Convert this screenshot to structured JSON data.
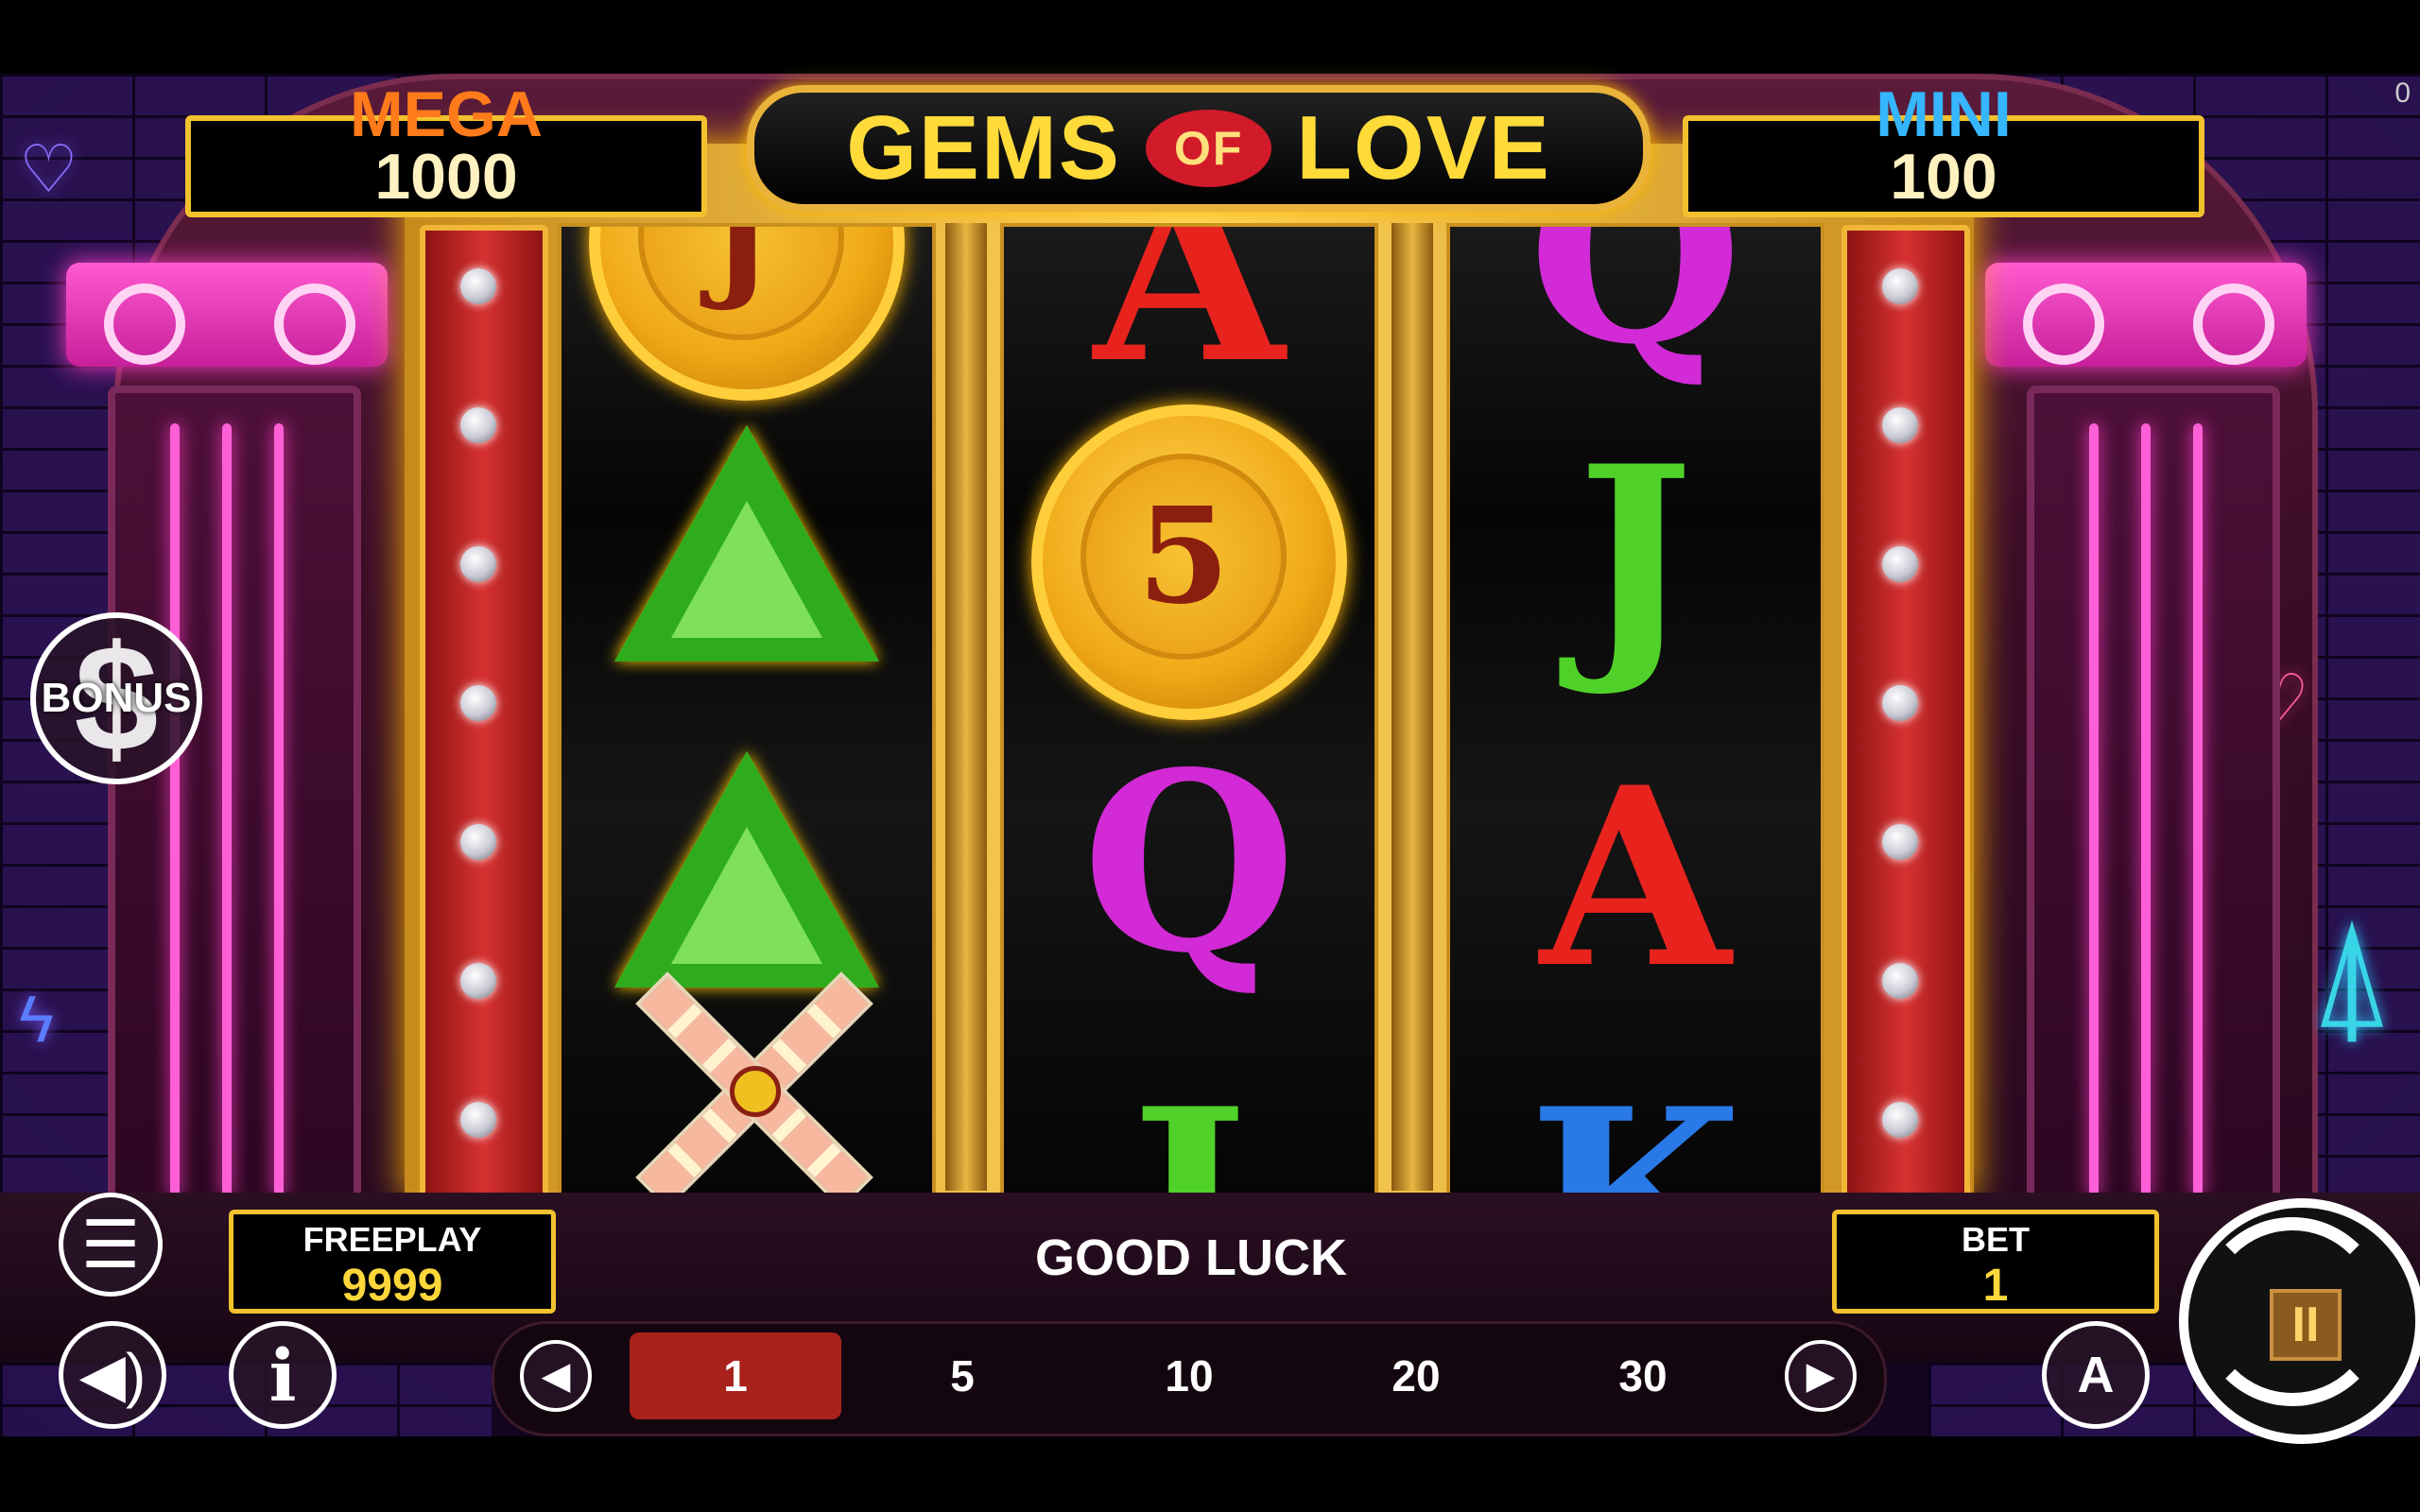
{
  "game": {
    "title": "GEMS OF LOVE",
    "title_left": "GEMS",
    "title_mid": "OF",
    "title_right": "LOVE"
  },
  "jackpots": {
    "mega": {
      "label": "MEGA",
      "value": "1000",
      "color": "#ff7a1a"
    },
    "mini": {
      "label": "MINI",
      "value": "100",
      "color": "#35b6ff"
    }
  },
  "counter": "0",
  "bonus_button": {
    "label": "BONUS",
    "symbol": "$"
  },
  "reels": [
    {
      "symbols": [
        "J",
        "green-gem",
        "green-gem",
        "windmill"
      ],
      "top_coin_label": "J"
    },
    {
      "symbols": [
        "A",
        "5",
        "Q",
        "J"
      ],
      "coin_value": "5"
    },
    {
      "symbols": [
        "Q",
        "J",
        "A",
        "K"
      ]
    }
  ],
  "status": {
    "freeplay_label": "FREEPLAY",
    "freeplay_value": "9999",
    "message": "GOOD LUCK",
    "bet_label": "BET",
    "bet_value": "1"
  },
  "bet_options": [
    "1",
    "5",
    "10",
    "20",
    "30"
  ],
  "selected_bet": "1",
  "controls": {
    "auto_label": "A",
    "pause_symbol": "II"
  },
  "colors": {
    "gold": "#f2c12e",
    "neon_pink": "#ff3dc5",
    "selected_bet": "#a8221b"
  }
}
